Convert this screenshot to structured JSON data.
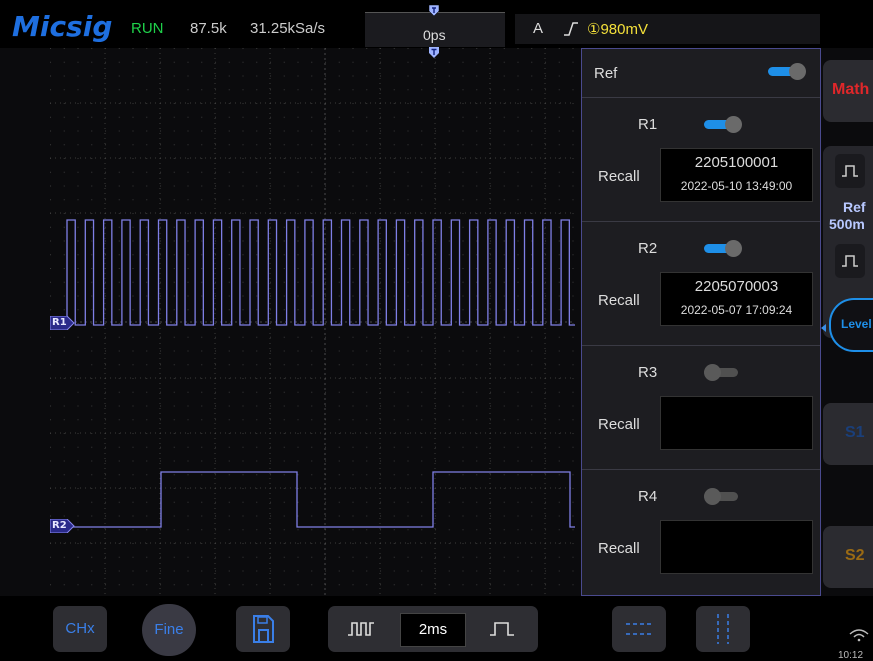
{
  "brand": "Micsig",
  "status": {
    "run_state": "RUN",
    "frequency": "87.5k",
    "sample_rate": "31.25kSa/s",
    "time_offset": "0ps"
  },
  "trigger": {
    "mode": "A",
    "edge_symbol": "⎍",
    "level": "①980mV"
  },
  "channels": {
    "r1_marker": "R1",
    "r2_marker": "R2"
  },
  "ref_panel": {
    "title": "Ref",
    "enabled": true,
    "slots": [
      {
        "name": "R1",
        "enabled": true,
        "recall_label": "Recall",
        "file_name": "2205100001",
        "file_date": "2022-05-10 13:49:00"
      },
      {
        "name": "R2",
        "enabled": true,
        "recall_label": "Recall",
        "file_name": "2205070003",
        "file_date": "2022-05-07 17:09:24"
      },
      {
        "name": "R3",
        "enabled": false,
        "recall_label": "Recall",
        "file_name": "",
        "file_date": ""
      },
      {
        "name": "R4",
        "enabled": false,
        "recall_label": "Recall",
        "file_name": "",
        "file_date": ""
      }
    ]
  },
  "side_menu": {
    "math_label": "Math",
    "ref_label": "Ref",
    "ref_scale": "500m",
    "level_label": "Level",
    "s1_label": "S1",
    "s2_label": "S2"
  },
  "bottom_bar": {
    "chx_label": "CHx",
    "fine_label": "Fine",
    "timebase": "2ms",
    "clock": "10:12"
  },
  "colors": {
    "accent_blue": "#1e6fe0",
    "run_green": "#1fd14a",
    "trigger_yellow": "#f4e03a",
    "waveform": "#7f7fe6",
    "math_red": "#e0272a"
  }
}
